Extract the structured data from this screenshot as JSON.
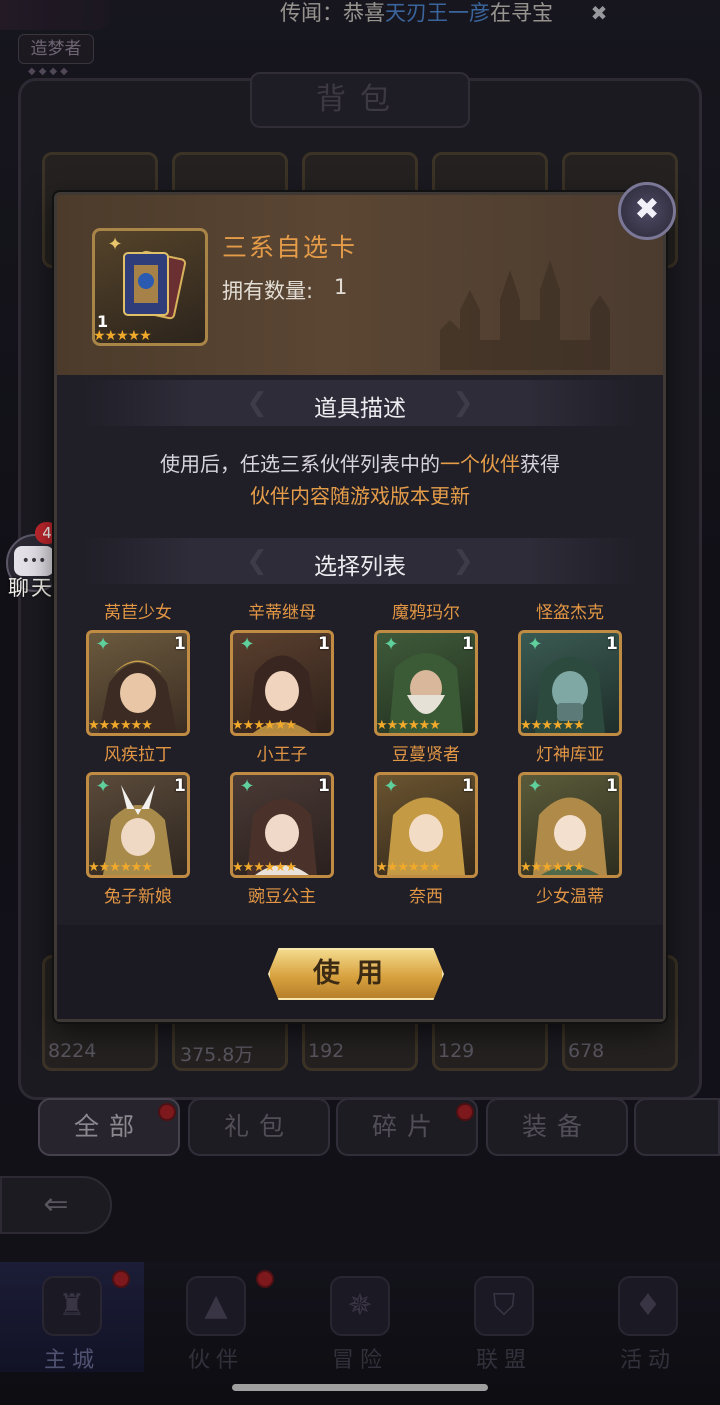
{
  "rumor": {
    "prefix": "传闻：恭喜",
    "name": "天刃王一彦",
    "suffix": "在寻宝"
  },
  "player_title": "造梦者",
  "bag": {
    "title": "背包",
    "bottom_counts": [
      "8224",
      "375.8万",
      "192",
      "129",
      "678"
    ],
    "tabs": [
      {
        "label": "全部",
        "has_dot": true,
        "active": true
      },
      {
        "label": "礼包",
        "has_dot": false,
        "active": false
      },
      {
        "label": "碎片",
        "has_dot": true,
        "active": false
      },
      {
        "label": "装备",
        "has_dot": false,
        "active": false
      }
    ]
  },
  "chat": {
    "label": "聊天",
    "badge": "4"
  },
  "bottom_nav": [
    {
      "label": "主城",
      "icon": "castle-icon",
      "has_dot": true,
      "active": true
    },
    {
      "label": "伙伴",
      "icon": "witch-hat-icon",
      "has_dot": true,
      "active": false
    },
    {
      "label": "冒险",
      "icon": "compass-icon",
      "has_dot": false,
      "active": false
    },
    {
      "label": "联盟",
      "icon": "shield-icon",
      "has_dot": false,
      "active": false
    },
    {
      "label": "活动",
      "icon": "cards-icon",
      "has_dot": false,
      "active": false
    }
  ],
  "modal": {
    "item_name": "三系自选卡",
    "count_label": "拥有数量:",
    "count_value": "1",
    "item_qty": "1",
    "item_stars": "★★★★★",
    "desc_section_title": "道具描述",
    "desc_line1_prefix": "使用后，任选三系伙伴列表中的",
    "desc_line1_highlight": "一个伙伴",
    "desc_line1_suffix": "获得",
    "desc_line2": "伙伴内容随游戏版本更新",
    "list_section_title": "选择列表",
    "use_button": "使用",
    "heroes": [
      {
        "name": "莴苣少女",
        "qty": "1",
        "stars": "★★★★★★"
      },
      {
        "name": "辛蒂继母",
        "qty": "1",
        "stars": "★★★★★★"
      },
      {
        "name": "魔鸦玛尔",
        "qty": "1",
        "stars": "★★★★★★"
      },
      {
        "name": "怪盗杰克",
        "qty": "1",
        "stars": "★★★★★★"
      },
      {
        "name": "风疾拉丁",
        "qty": "1",
        "stars": "★★★★★★"
      },
      {
        "name": "小王子",
        "qty": "1",
        "stars": "★★★★★★"
      },
      {
        "name": "豆蔓贤者",
        "qty": "1",
        "stars": "★★★★★★"
      },
      {
        "name": "灯神库亚",
        "qty": "1",
        "stars": "★★★★★★"
      }
    ],
    "hero_extra_names": [
      "兔子新娘",
      "豌豆公主",
      "奈西",
      "少女温蒂"
    ]
  }
}
